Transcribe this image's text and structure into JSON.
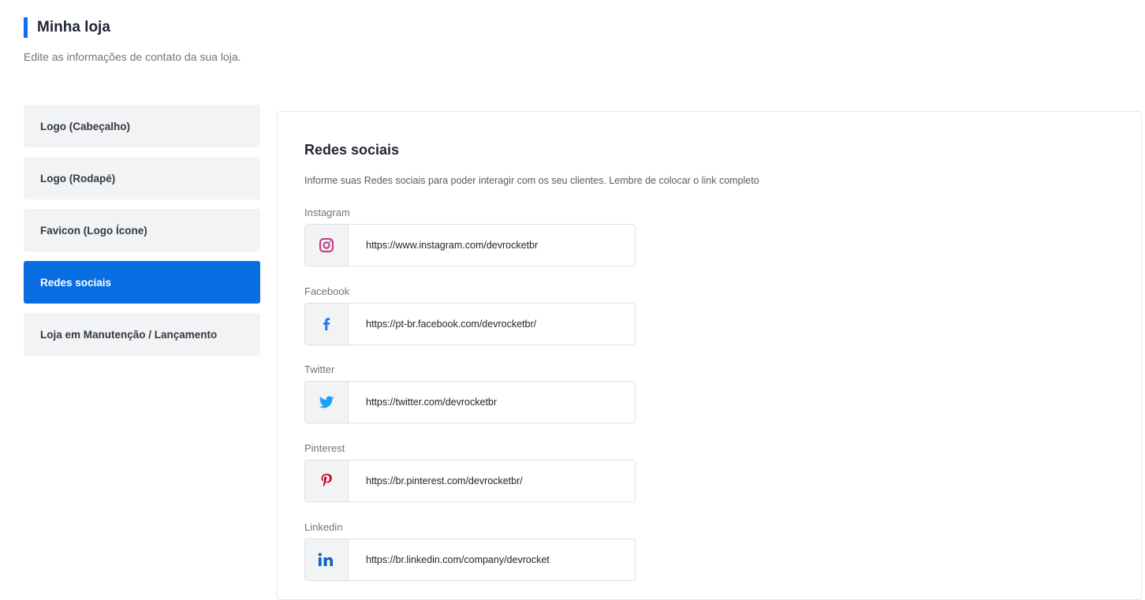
{
  "header": {
    "title": "Minha loja",
    "subtitle": "Edite as informações de contato da sua loja."
  },
  "sidebar": {
    "items": [
      {
        "label": "Logo (Cabeçalho)",
        "active": false
      },
      {
        "label": "Logo (Rodapé)",
        "active": false
      },
      {
        "label": "Favicon (Logo Ícone)",
        "active": false
      },
      {
        "label": "Redes sociais",
        "active": true
      },
      {
        "label": "Loja em Manutenção / Lançamento",
        "active": false
      }
    ]
  },
  "content": {
    "title": "Redes sociais",
    "description": "Informe suas Redes sociais para poder interagir com os seu clientes. Lembre de colocar o link completo",
    "fields": [
      {
        "label": "Instagram",
        "icon": "instagram-icon",
        "value": "https://www.instagram.com/devrocketbr"
      },
      {
        "label": "Facebook",
        "icon": "facebook-icon",
        "value": "https://pt-br.facebook.com/devrocketbr/"
      },
      {
        "label": "Twitter",
        "icon": "twitter-icon",
        "value": "https://twitter.com/devrocketbr"
      },
      {
        "label": "Pinterest",
        "icon": "pinterest-icon",
        "value": "https://br.pinterest.com/devrocketbr/"
      },
      {
        "label": "Linkedin",
        "icon": "linkedin-icon",
        "value": "https://br.linkedin.com/company/devrocket"
      }
    ]
  },
  "colors": {
    "accent": "#0a6ee3",
    "instagram": "#c13584",
    "facebook": "#1877f2",
    "twitter": "#1da1f2",
    "pinterest": "#bd081c",
    "linkedin": "#0a66c2"
  }
}
